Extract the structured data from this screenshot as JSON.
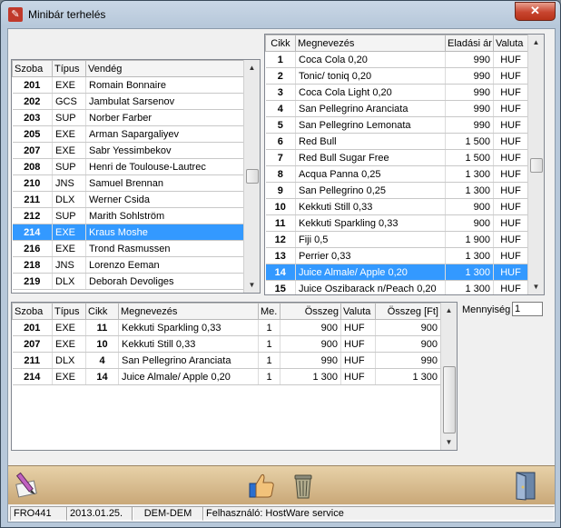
{
  "window": {
    "title": "Minibár terhelés",
    "close_label": "✕"
  },
  "guests": {
    "headers": [
      "Szoba",
      "Típus",
      "Vendég"
    ],
    "rows": [
      [
        "201",
        "EXE",
        "Romain Bonnaire"
      ],
      [
        "202",
        "GCS",
        "Jambulat Sarsenov"
      ],
      [
        "203",
        "SUP",
        "Norber Farber"
      ],
      [
        "205",
        "EXE",
        "Arman Sapargaliyev"
      ],
      [
        "207",
        "EXE",
        "Sabr Yessimbekov"
      ],
      [
        "208",
        "SUP",
        "Henri de Toulouse-Lautrec"
      ],
      [
        "210",
        "JNS",
        "Samuel Brennan"
      ],
      [
        "211",
        "DLX",
        "Werner Csida"
      ],
      [
        "212",
        "SUP",
        "Marith Sohlström"
      ],
      [
        "214",
        "EXE",
        "Kraus Moshe"
      ],
      [
        "216",
        "EXE",
        "Trond Rasmussen"
      ],
      [
        "218",
        "JNS",
        "Lorenzo Eeman"
      ],
      [
        "219",
        "DLX",
        "Deborah Devoliges"
      ]
    ],
    "selected_index": 9
  },
  "products": {
    "headers": [
      "Cikk",
      "Megnevezés",
      "Eladási ár",
      "Valuta"
    ],
    "rows": [
      [
        "1",
        "Coca Cola 0,20",
        "990",
        "HUF"
      ],
      [
        "2",
        "Tonic/ toniq 0,20",
        "990",
        "HUF"
      ],
      [
        "3",
        "Coca Cola Light 0,20",
        "990",
        "HUF"
      ],
      [
        "4",
        "San Pellegrino Aranciata",
        "990",
        "HUF"
      ],
      [
        "5",
        "San Pellegrino Lemonata",
        "990",
        "HUF"
      ],
      [
        "6",
        "Red Bull",
        "1 500",
        "HUF"
      ],
      [
        "7",
        "Red Bull Sugar Free",
        "1 500",
        "HUF"
      ],
      [
        "8",
        "Acqua Panna 0,25",
        "1 300",
        "HUF"
      ],
      [
        "9",
        "San Pellegrino 0,25",
        "1 300",
        "HUF"
      ],
      [
        "10",
        "Kekkuti Still 0,33",
        "900",
        "HUF"
      ],
      [
        "11",
        "Kekkuti Sparkling 0,33",
        "900",
        "HUF"
      ],
      [
        "12",
        "Fiji 0,5",
        "1 900",
        "HUF"
      ],
      [
        "13",
        "Perrier 0,33",
        "1 300",
        "HUF"
      ],
      [
        "14",
        "Juice Almale/ Apple 0,20",
        "1 300",
        "HUF"
      ],
      [
        "15",
        "Juice Oszibarack n/Peach 0,20",
        "1 300",
        "HUF"
      ]
    ],
    "selected_index": 13
  },
  "charges": {
    "headers": [
      "Szoba",
      "Típus",
      "Cikk",
      "Megnevezés",
      "Me.",
      "Összeg",
      "Valuta",
      "Összeg [Ft]"
    ],
    "rows": [
      [
        "201",
        "EXE",
        "11",
        "Kekkuti Sparkling 0,33",
        "1",
        "900",
        "HUF",
        "900"
      ],
      [
        "207",
        "EXE",
        "10",
        "Kekkuti Still 0,33",
        "1",
        "900",
        "HUF",
        "900"
      ],
      [
        "211",
        "DLX",
        "4",
        "San Pellegrino Aranciata",
        "1",
        "990",
        "HUF",
        "990"
      ],
      [
        "214",
        "EXE",
        "14",
        "Juice Almale/ Apple 0,20",
        "1",
        "1 300",
        "HUF",
        "1 300"
      ]
    ]
  },
  "quantity": {
    "label": "Mennyiség",
    "value": "1"
  },
  "toolbar": {
    "icons": [
      "edit-icon",
      "thumbs-up-icon",
      "trash-icon",
      "exit-door-icon"
    ]
  },
  "statusbar": {
    "terminal": "FRO441",
    "date": "2013.01.25.",
    "database": "DEM-DEM",
    "user": "Felhasználó: HostWare service"
  },
  "colors": {
    "selection": "#3399ff",
    "toolbar": "#d9bf94"
  }
}
